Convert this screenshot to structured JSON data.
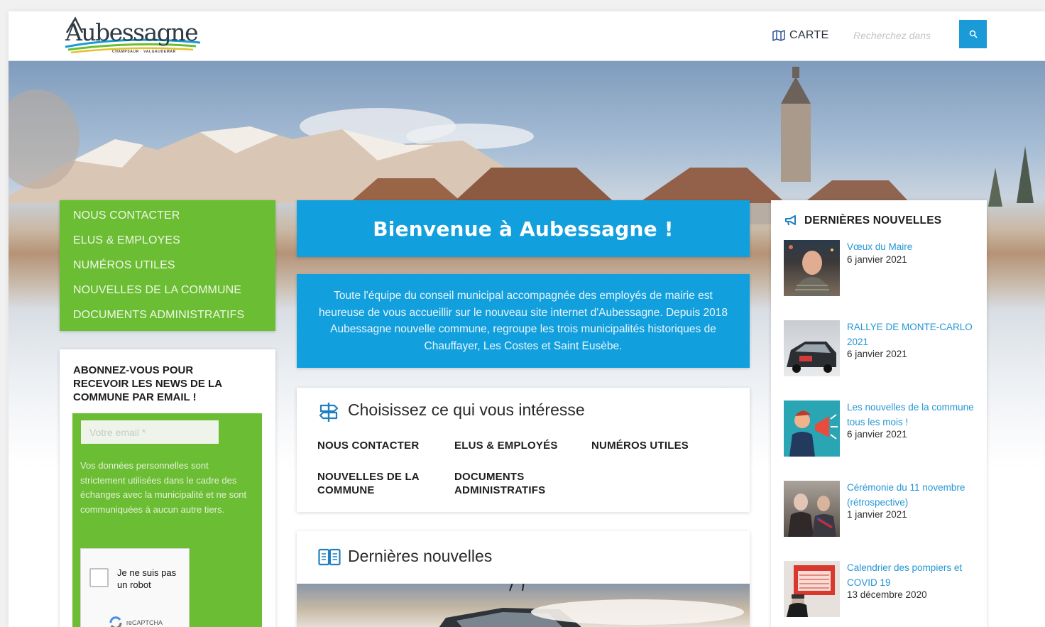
{
  "header": {
    "logo_text": "Aubessagne",
    "logo_subtitle": "CHAMPSAUR · VALGAUDEMAR",
    "map_label": "CARTE",
    "search_placeholder": "Recherchez dans"
  },
  "left_menu": {
    "items": [
      "NOUS CONTACTER",
      "ELUS & EMPLOYES",
      "NUMÉROS UTILES",
      "NOUVELLES DE LA COMMUNE",
      "DOCUMENTS ADMINISTRATIFS"
    ]
  },
  "subscribe": {
    "title": "ABONNEZ-VOUS POUR RECEVOIR LES NEWS DE LA COMMUNE PAR EMAIL !",
    "email_placeholder": "Votre email *",
    "privacy_text": "Vos données personnelles sont strictement utilisées dans le cadre des échanges avec la municipalité et ne sont communiquées à aucun autre tiers.",
    "captcha_label": "Je ne suis pas un robot",
    "captcha_brand": "reCAPTCHA"
  },
  "welcome": {
    "title": "Bienvenue à Aubessagne !",
    "intro": "Toute l'équipe du conseil municipal accompagnée des employés de mairie est heureuse de vous accueillir sur le nouveau site internet d'Aubessagne. Depuis 2018 Aubessagne nouvelle commune, regroupe les trois municipalités historiques de Chauffayer, Les Costes et Saint Eusèbe."
  },
  "choose": {
    "title": "Choisissez ce qui vous intéresse",
    "links": [
      "NOUS CONTACTER",
      "ELUS & EMPLOYÉS",
      "NUMÉROS UTILES",
      "NOUVELLES DE LA COMMUNE",
      "DOCUMENTS ADMINISTRATIFS"
    ]
  },
  "latest_block": {
    "title": "Dernières nouvelles"
  },
  "sidebar": {
    "title": "DERNIÈRES NOUVELLES",
    "items": [
      {
        "title": "Vœux du Maire",
        "date": "6 janvier 2021",
        "thumb": "portrait"
      },
      {
        "title": "RALLYE DE MONTE-CARLO 2021",
        "date": "6 janvier 2021",
        "thumb": "rally-car"
      },
      {
        "title": "Les nouvelles de la commune tous les mois !",
        "date": "6 janvier 2021",
        "thumb": "megaphone-illustration"
      },
      {
        "title": "Cérémonie du 11 novembre (rétrospective)",
        "date": "1 janvier 2021",
        "thumb": "ceremony"
      },
      {
        "title": "Calendrier des pompiers et COVID 19",
        "date": "13 décembre 2020",
        "thumb": "firefighter-calendar"
      }
    ]
  },
  "colors": {
    "brand_blue": "#129fde",
    "brand_green": "#6bbd33",
    "link_blue": "#2496d4",
    "search_button": "#1a9ad6"
  }
}
